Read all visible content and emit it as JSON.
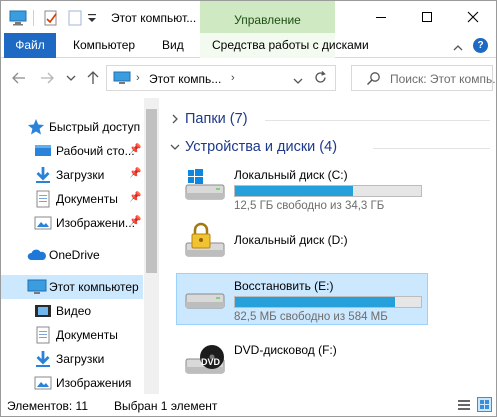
{
  "window": {
    "title": "Этот компьют...",
    "context_tab_title": "Управление"
  },
  "ribbon": {
    "tabs": [
      {
        "label": "Файл"
      },
      {
        "label": "Компьютер"
      },
      {
        "label": "Вид"
      },
      {
        "label": "Средства работы с дисками"
      }
    ]
  },
  "address": {
    "crumb": "Этот компь..."
  },
  "search": {
    "placeholder": "Поиск: Этот компь..."
  },
  "nav": {
    "items": [
      {
        "label": "Быстрый доступ",
        "icon": "star-icon"
      },
      {
        "label": "Рабочий сто...",
        "icon": "desktop-icon"
      },
      {
        "label": "Загрузки",
        "icon": "download-icon"
      },
      {
        "label": "Документы",
        "icon": "documents-icon"
      },
      {
        "label": "Изображени...",
        "icon": "pictures-icon"
      },
      {
        "label": "OneDrive",
        "icon": "cloud-icon"
      },
      {
        "label": "Этот компьютер",
        "icon": "computer-icon"
      },
      {
        "label": "Видео",
        "icon": "video-icon"
      },
      {
        "label": "Документы",
        "icon": "documents-icon"
      },
      {
        "label": "Загрузки",
        "icon": "download-icon"
      },
      {
        "label": "Изображения",
        "icon": "pictures-icon"
      }
    ]
  },
  "content": {
    "groups": [
      {
        "title": "Папки (7)"
      },
      {
        "title": "Устройства и диски (4)"
      }
    ],
    "drives": [
      {
        "name": "Локальный диск (C:)",
        "free": "12,5 ГБ свободно из 34,3 ГБ",
        "used_fraction": 0.636,
        "icon": "windows-drive-icon"
      },
      {
        "name": "Локальный диск (D:)",
        "icon": "locked-drive-icon"
      },
      {
        "name": "Восстановить (E:)",
        "free": "82,5 МБ свободно из 584 МБ",
        "used_fraction": 0.859,
        "icon": "drive-icon"
      },
      {
        "name": "DVD-дисковод (F:)",
        "icon": "dvd-drive-icon",
        "badge": "DVD"
      }
    ]
  },
  "status": {
    "count": "Элементов: 11",
    "selection": "Выбран 1 элемент"
  },
  "colors": {
    "accent": "#1e69c4",
    "context_tab": "#cfe9c2",
    "selection": "#cce8ff",
    "usage_bar": "#26a0da"
  }
}
